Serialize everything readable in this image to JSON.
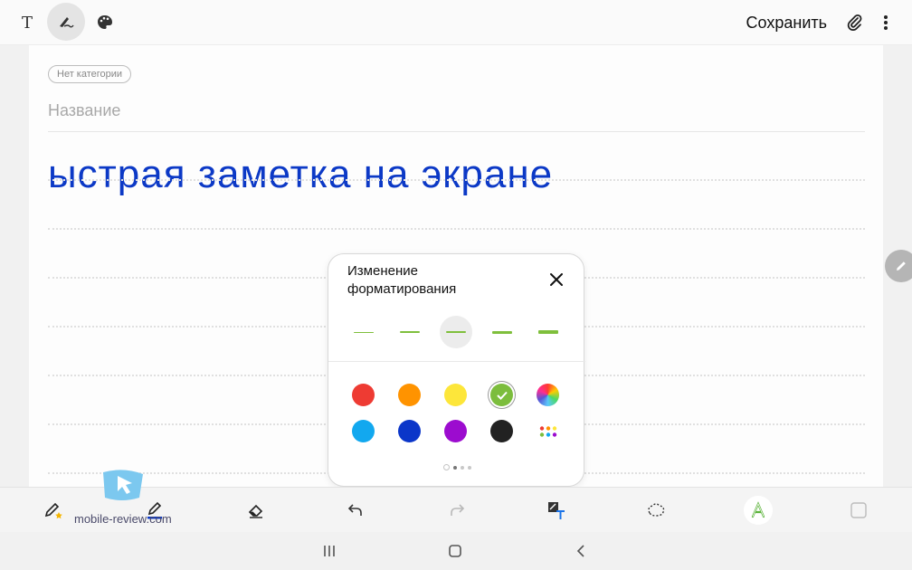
{
  "toolbar_top": {
    "text_mode_icon": "T",
    "save_label": "Сохранить"
  },
  "note": {
    "category_chip": "Нет категории",
    "title_placeholder": "Название",
    "handwriting_text": "ыстрая заметка на экране"
  },
  "format_popup": {
    "title": "Изменение форматирования",
    "thicknesses": [
      {
        "level": 1,
        "selected": false
      },
      {
        "level": 2,
        "selected": false
      },
      {
        "level": 3,
        "selected": true
      },
      {
        "level": 4,
        "selected": false
      },
      {
        "level": 5,
        "selected": false
      }
    ],
    "colors": [
      {
        "name": "red",
        "hex": "#ee3b33",
        "selected": false
      },
      {
        "name": "orange",
        "hex": "#ff9300",
        "selected": false
      },
      {
        "name": "yellow",
        "hex": "#fde63a",
        "selected": false
      },
      {
        "name": "green",
        "hex": "#7cbd3d",
        "selected": true
      },
      {
        "name": "spectrum",
        "hex": "gradient",
        "selected": false
      },
      {
        "name": "light-blue",
        "hex": "#12a8ef",
        "selected": false
      },
      {
        "name": "blue",
        "hex": "#0b36c9",
        "selected": false
      },
      {
        "name": "purple",
        "hex": "#9c0ccf",
        "selected": false
      },
      {
        "name": "black",
        "hex": "#222222",
        "selected": false
      },
      {
        "name": "more-colors",
        "hex": "palette",
        "selected": false
      }
    ],
    "pager": {
      "pages": 3,
      "current": 1
    }
  },
  "watermark": {
    "text": "mobile-review.com"
  },
  "bottom_tools": [
    "favorite-pen-icon",
    "pen-icon",
    "eraser-icon",
    "undo-icon",
    "redo-icon",
    "text-convert-icon",
    "lasso-icon",
    "handwriting-icon",
    "checkbox-icon"
  ],
  "colors": {
    "accent_green": "#7cbd3d",
    "ink_blue": "#0c39c6"
  }
}
